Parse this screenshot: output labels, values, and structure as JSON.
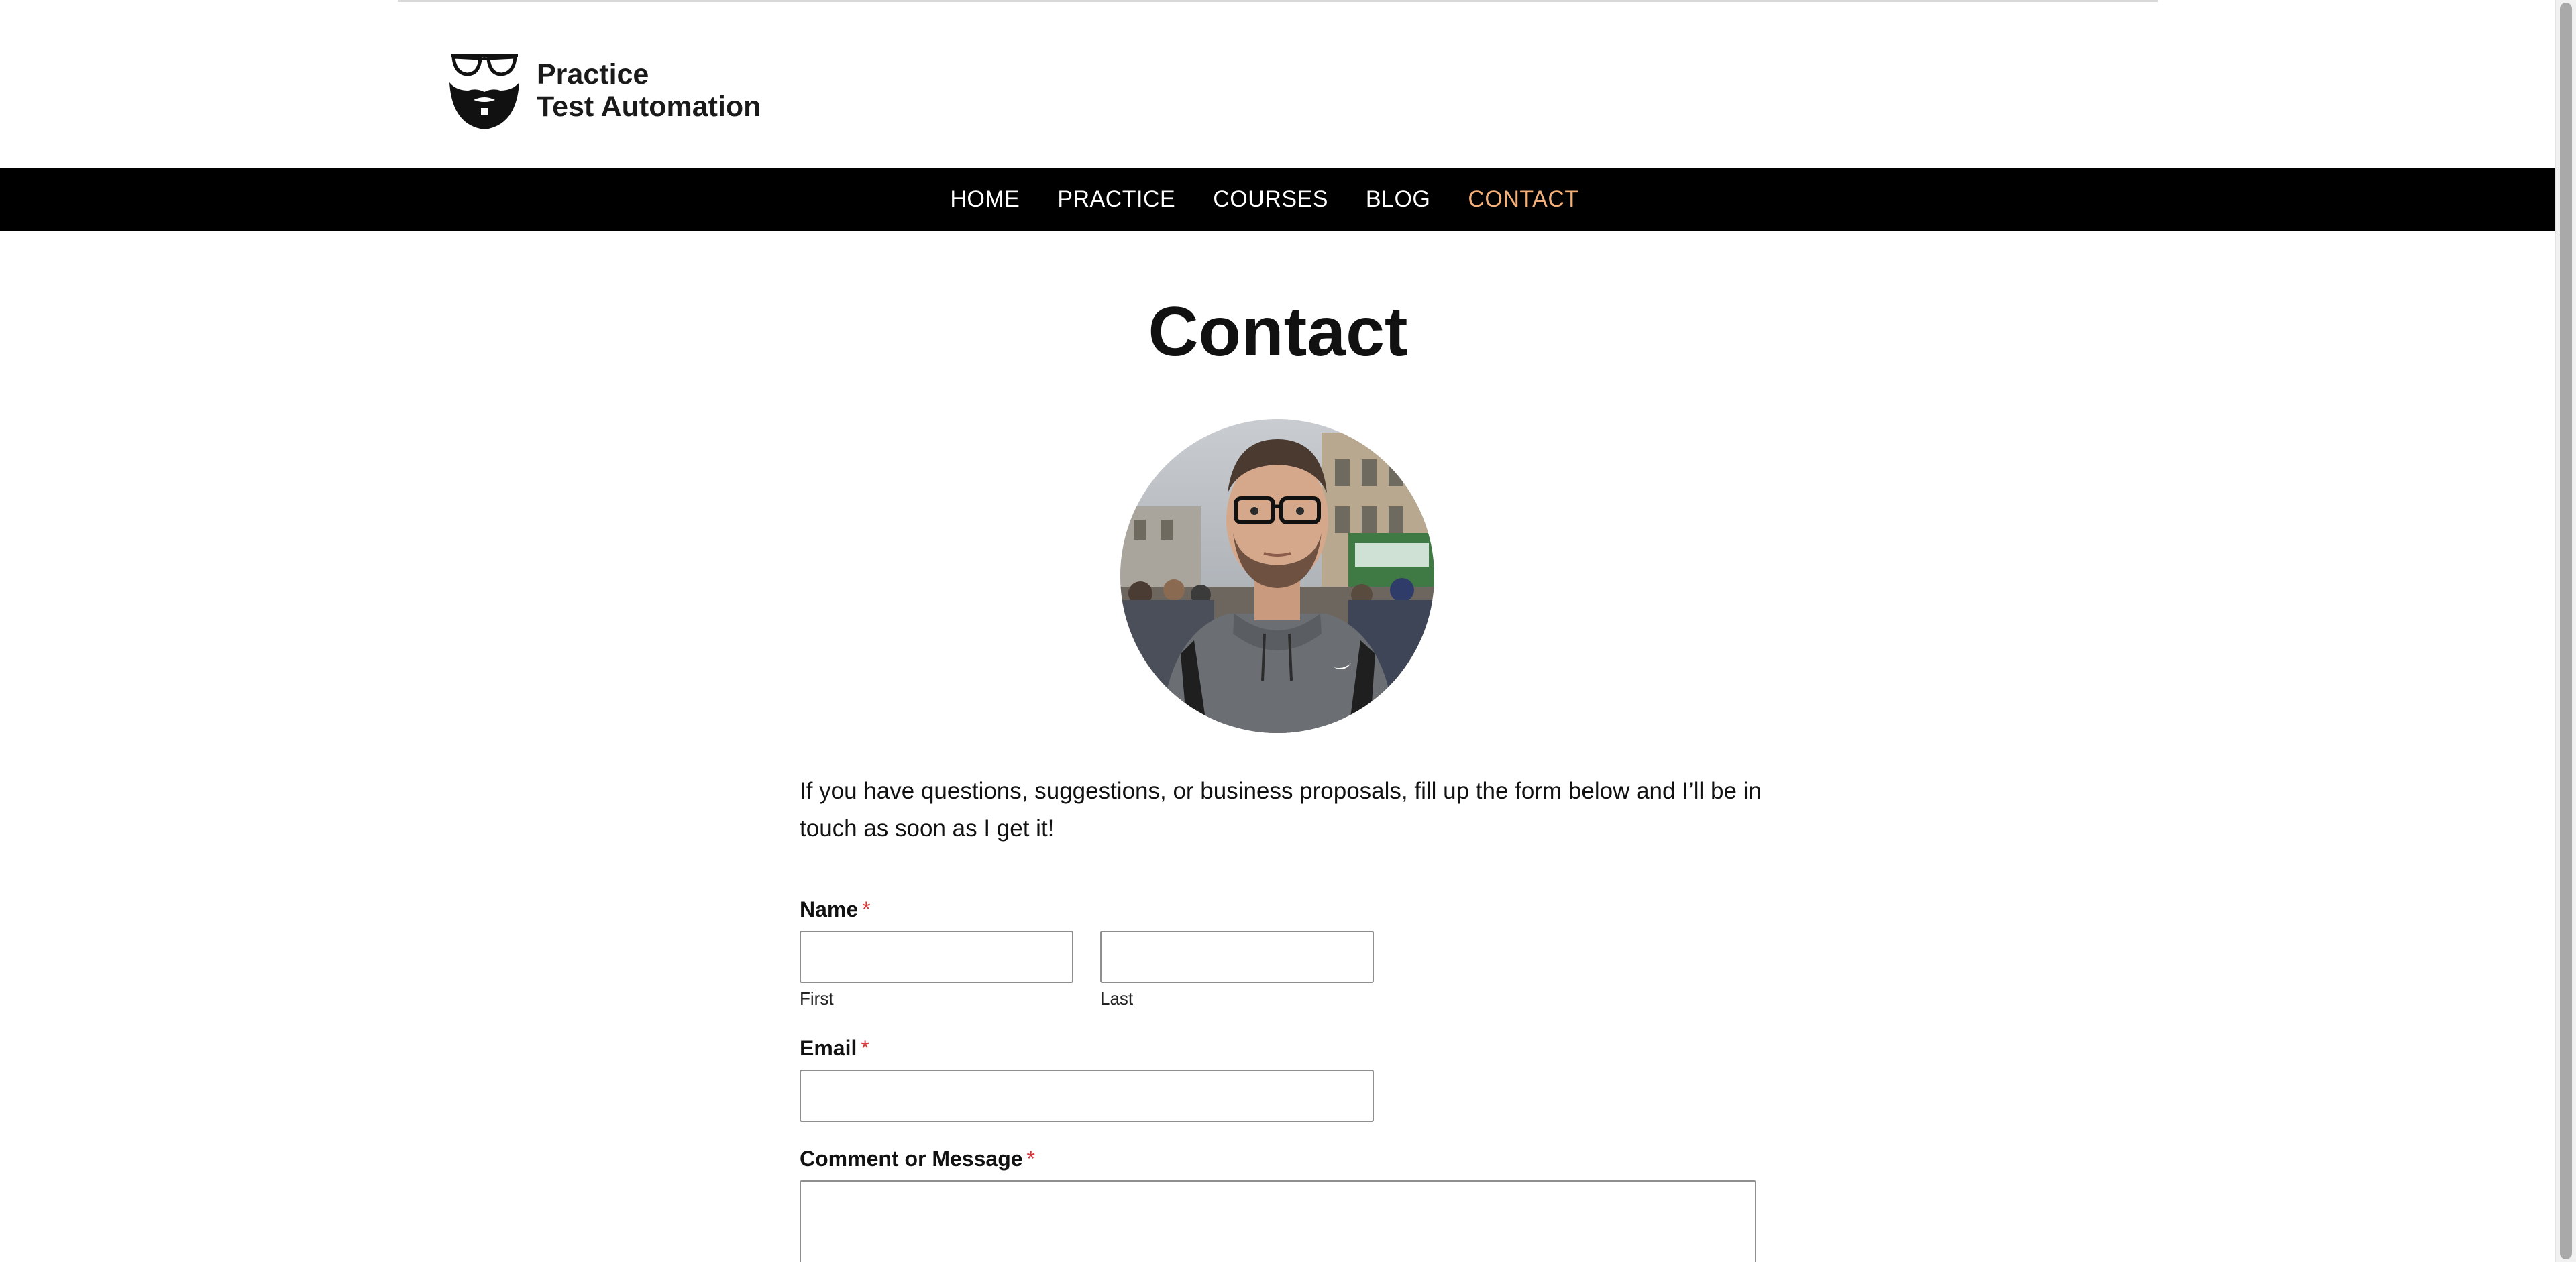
{
  "brand": {
    "line1": "Practice",
    "line2": "Test Automation"
  },
  "nav": {
    "items": [
      {
        "label": "HOME",
        "active": false
      },
      {
        "label": "PRACTICE",
        "active": false
      },
      {
        "label": "COURSES",
        "active": false
      },
      {
        "label": "BLOG",
        "active": false
      },
      {
        "label": "CONTACT",
        "active": true
      }
    ],
    "active_color": "#f5b07a"
  },
  "page": {
    "title": "Contact",
    "intro": "If you have questions, suggestions, or business proposals, fill up the form below and I’ll be in touch as soon as I get it!"
  },
  "form": {
    "name_label": "Name",
    "required_mark": "*",
    "first_sublabel": "First",
    "last_sublabel": "Last",
    "first_value": "",
    "last_value": "",
    "email_label": "Email",
    "email_value": "",
    "message_label": "Comment or Message",
    "message_value": ""
  },
  "colors": {
    "navbar_bg": "#000000",
    "required": "#d63638"
  }
}
